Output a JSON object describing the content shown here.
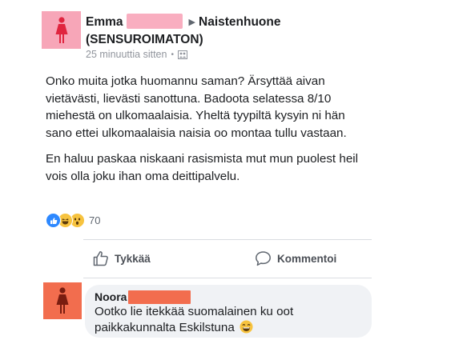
{
  "post": {
    "author_first_name": "Emma",
    "group_name": "Naistenhuone",
    "group_suffix": "(SENSUROIMATON)",
    "timestamp": "25 minuuttia sitten",
    "paragraphs": [
      "Onko muita jotka huomannu saman? Ärsyttää aivan vietävästi, lievästi sanottuna. Badoota selatessa 8/10 miehestä on ulkomaalaisia. Yheltä tyypiltä kysyin ni hän sano ettei ulkomaalaisia naisia oo montaa tullu vastaan.",
      "En haluu paskaa niskaani rasismista mut mun puolest heil vois olla joku ihan oma deittipalvelu."
    ],
    "reaction_count": "70"
  },
  "actions": {
    "like_label": "Tykkää",
    "comment_label": "Kommentoi"
  },
  "comment": {
    "author_first_name": "Noora",
    "text": "Ootko lie itekkää suomalainen ku oot paikkakunnalta Eskilstuna"
  },
  "colors": {
    "post_avatar_bg": "#f7a6b8",
    "comment_avatar_bg": "#f26d4e",
    "like_blue": "#2d88ff",
    "emoji_yellow": "#f7c33f"
  },
  "icons": {
    "avatar": "female-figure-icon",
    "arrow": "triangle-right-icon",
    "audience": "group-audience-icon",
    "like": "thumbs-up-outline-icon",
    "comment": "speech-bubble-outline-icon"
  }
}
